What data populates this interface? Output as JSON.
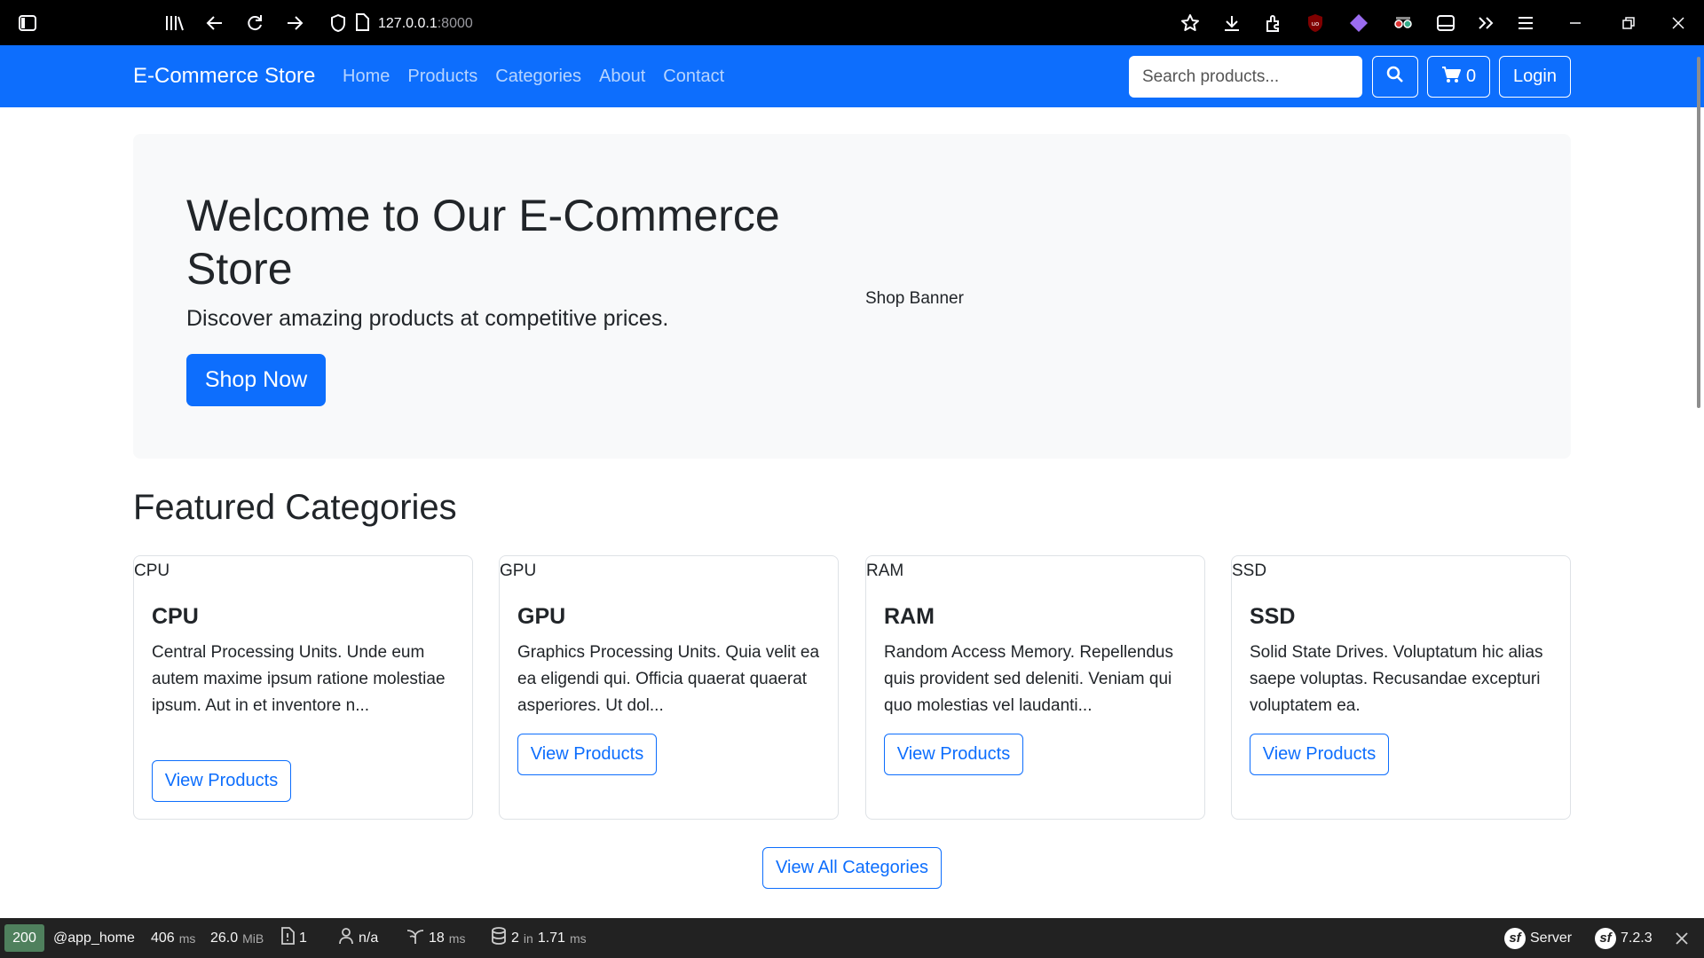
{
  "browser": {
    "url_host": "127.0.0.1",
    "url_port": ":8000",
    "icons": [
      "sidebar-icon",
      "library-icon",
      "back-icon",
      "reload-icon",
      "forward-icon",
      "shield-icon",
      "page-icon",
      "bookmark-star-icon",
      "download-icon",
      "extensions-icon",
      "ublock-icon",
      "extension-diamond-icon",
      "extension-glasses-icon",
      "tab-view-icon",
      "overflow-icon",
      "menu-icon",
      "minimize-icon",
      "restore-icon",
      "close-icon"
    ]
  },
  "navbar": {
    "brand": "E-Commerce Store",
    "links": [
      "Home",
      "Products",
      "Categories",
      "About",
      "Contact"
    ],
    "search_placeholder": "Search products...",
    "cart_count": "0",
    "login_label": "Login"
  },
  "hero": {
    "title": "Welcome to Our E-Commerce Store",
    "lead": "Discover amazing products at competitive prices.",
    "button": "Shop Now",
    "banner_alt": "Shop Banner"
  },
  "featured": {
    "title": "Featured Categories",
    "cards": [
      {
        "img_alt": "CPU",
        "title": "CPU",
        "text": "Central Processing Units. Unde eum autem maxime ipsum ratione molestiae ipsum. Aut in et inventore n...",
        "button": "View Products"
      },
      {
        "img_alt": "GPU",
        "title": "GPU",
        "text": "Graphics Processing Units. Quia velit ea ea eligendi qui. Officia quaerat quaerat asperiores. Ut dol...",
        "button": "View Products"
      },
      {
        "img_alt": "RAM",
        "title": "RAM",
        "text": "Random Access Memory. Repellendus quis provident sed deleniti. Veniam qui quo molestias vel laudanti...",
        "button": "View Products"
      },
      {
        "img_alt": "SSD",
        "title": "SSD",
        "text": "Solid State Drives. Voluptatum hic alias saepe voluptas. Recusandae excepturi voluptatem ea.",
        "button": "View Products"
      }
    ],
    "view_all": "View All Categories"
  },
  "debug_toolbar": {
    "status": "200",
    "route": "@app_home",
    "time": "406",
    "time_unit": "ms",
    "memory": "26.0",
    "memory_unit": "MiB",
    "logs": "1",
    "user": "n/a",
    "twig": "18",
    "twig_unit": "ms",
    "db_queries": "2",
    "db_in": "in",
    "db_time": "1.71",
    "db_unit": "ms",
    "server": "Server",
    "version": "7.2.3"
  },
  "colors": {
    "primary": "#0d6efd",
    "hero_bg": "#f8f9fa",
    "toolbar_bg": "#222222",
    "status_ok": "#4f805d"
  }
}
